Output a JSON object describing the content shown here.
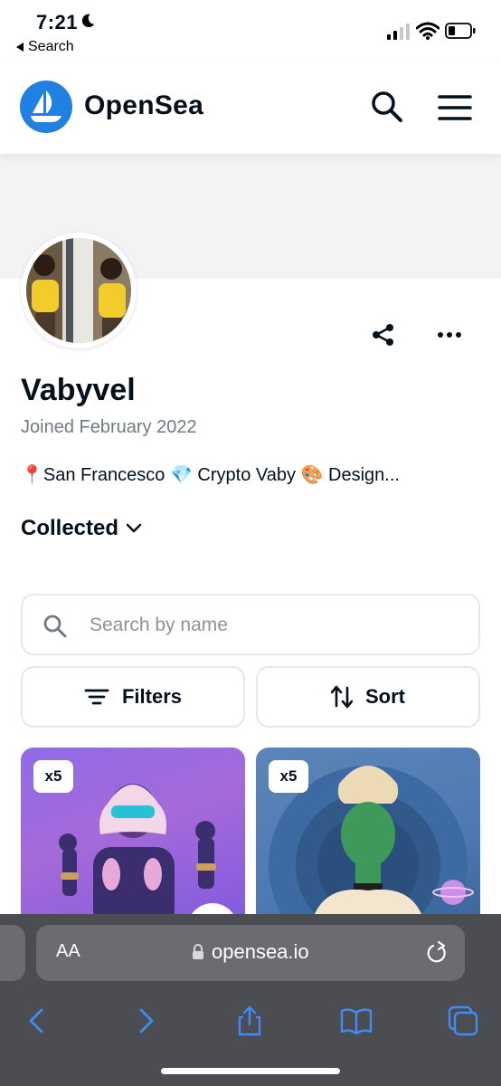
{
  "status_bar": {
    "time": "7:21",
    "back_label": "Search"
  },
  "header": {
    "brand": "OpenSea",
    "colors": {
      "brand_blue": "#2081e2"
    }
  },
  "profile": {
    "name": "Vabyvel",
    "joined": "Joined February 2022",
    "bio": "📍San Francesco 💎 Crypto Vaby 🎨 Design...",
    "tab": "Collected"
  },
  "search": {
    "placeholder": "Search by name"
  },
  "controls": {
    "filters_label": "Filters",
    "sort_label": "Sort"
  },
  "cards": [
    {
      "quantity": "x5"
    },
    {
      "quantity": "x5"
    }
  ],
  "safari": {
    "text_size_label": "AA",
    "url": "opensea.io"
  }
}
